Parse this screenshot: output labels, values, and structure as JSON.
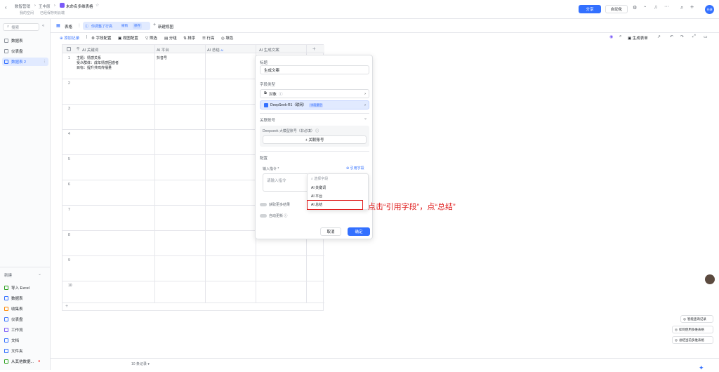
{
  "topbar": {
    "crumb1": "数智营销",
    "crumb2": "王中原",
    "doc_title": "未命名多维表格",
    "sub1": "我的空间",
    "sub2": "已经保存到云端",
    "share": "分享",
    "automate": "自动化",
    "avatar": "孙源"
  },
  "sidebar": {
    "search_placeholder": "搜索",
    "items": [
      "数据表",
      "仪表盘",
      "数据表 2"
    ],
    "new_label": "新建",
    "new_items": [
      "导入 Excel",
      "数据表",
      "收集表",
      "仪表盘",
      "工作流",
      "文档",
      "文件夹",
      "从其他数据..."
    ]
  },
  "view_tabs": {
    "grid_view": "表格",
    "notice": "你调整了行高",
    "reset": "撤销",
    "save": "保存",
    "new_view": "新建视图"
  },
  "toolbar": {
    "add_record": "添加记录",
    "field_config": "字段配置",
    "view_config": "视图配置",
    "filter": "筛选",
    "group": "分组",
    "sort": "排序",
    "row_height": "行高",
    "fill_color": "填色",
    "generate_form": "生成表单"
  },
  "table": {
    "headers": [
      "关键词",
      "平台",
      "总结",
      "生成文案"
    ],
    "ai_badge": "AI",
    "row1": {
      "keyword_lines": [
        "主题：情感关系",
        "受众群体：成年情感困惑者",
        "目标：提升共鸣传播量"
      ],
      "platform": "抖音号"
    },
    "row_numbers": [
      "1",
      "2",
      "3",
      "4",
      "5",
      "6",
      "7",
      "8",
      "9",
      "10"
    ],
    "record_count": "10 条记录"
  },
  "panel": {
    "title_label": "标题",
    "title_value": "生成文案",
    "type_label": "字段类型",
    "type_value": "对象",
    "model": "DeepSeek-R1（联网）",
    "model_badge": "字段捷径",
    "account_label": "关联账号",
    "account_hint": "Deepseek 大模型账号（非必填）",
    "account_btn": "+ 关联账号",
    "config_label": "配置",
    "input_label": "输入指令 *",
    "ref_field": "引用字段",
    "input_placeholder": "请输入指令",
    "more_results": "获取更多结果",
    "auto_update": "自动更新",
    "cancel": "取消",
    "confirm": "确定"
  },
  "dropdown": {
    "search_placeholder": "选择字段",
    "options": [
      "关键词",
      "平台",
      "总结"
    ]
  },
  "annotation": "点击“引用字段”，点“总结”",
  "right_float": [
    "智能查询记录",
    "如何使用多维表格",
    "总结当前多维表格"
  ],
  "colors": {
    "accent": "#3370ff",
    "annotation": "#e02020"
  }
}
